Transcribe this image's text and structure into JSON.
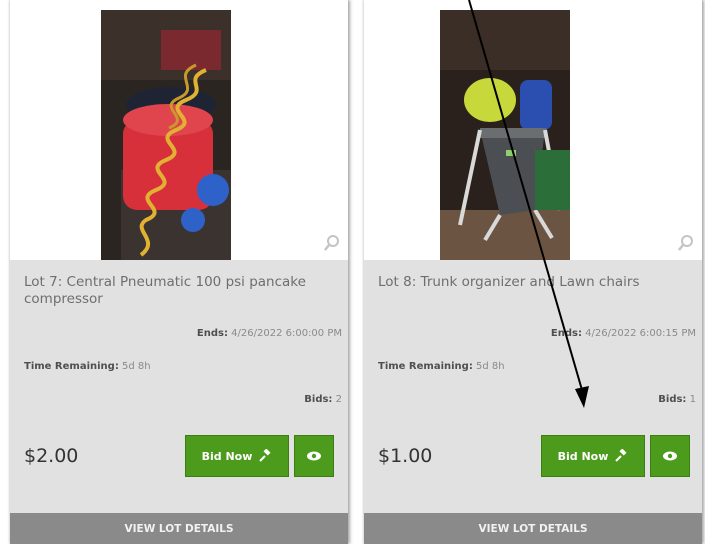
{
  "lots": [
    {
      "title": "Lot 7:  Central Pneumatic 100 psi pancake compressor",
      "ends_label": "Ends:",
      "ends_value": "4/26/2022 6:00:00 PM",
      "remaining_label": "Time Remaining:",
      "remaining_value": "5d  8h",
      "bids_label": "Bids:",
      "bids_value": "2",
      "price": "$2.00",
      "bid_button": "Bid Now",
      "details_link": "VIEW LOT DETAILS"
    },
    {
      "title": "Lot 8:  Trunk organizer and Lawn chairs",
      "ends_label": "Ends:",
      "ends_value": "4/26/2022 6:00:15 PM",
      "remaining_label": "Time Remaining:",
      "remaining_value": "5d  8h",
      "bids_label": "Bids:",
      "bids_value": "1",
      "price": "$1.00",
      "bid_button": "Bid Now",
      "details_link": "VIEW LOT DETAILS"
    }
  ],
  "icons": {
    "bid": "gavel-icon",
    "watch": "eye-icon",
    "zoom": "magnifier-icon"
  },
  "colors": {
    "button_green": "#4c9b1c",
    "info_panel": "#e1e1e1",
    "details_bar": "#8a8a8a"
  }
}
